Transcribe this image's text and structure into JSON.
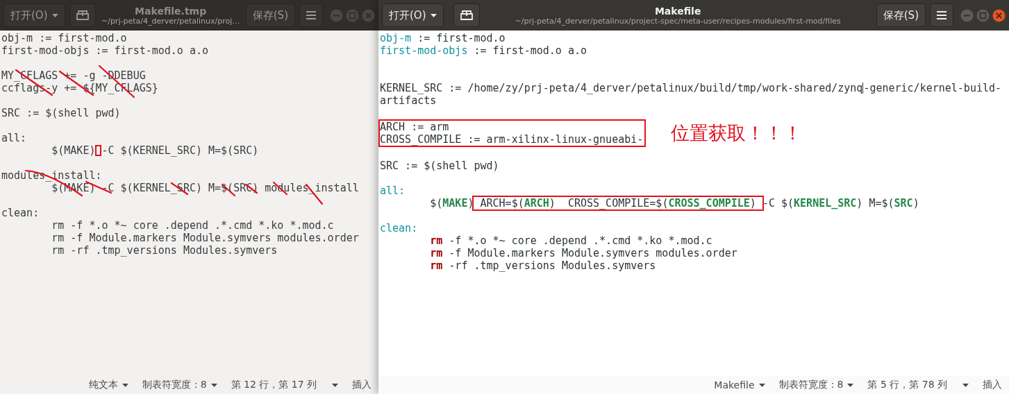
{
  "windows": [
    {
      "active": false,
      "struck_out": true,
      "open_button": "打开(O)",
      "save_button": "保存(S)",
      "title": "Makefile.tmp",
      "path": "~/prj-peta/4_derver/petalinux/proj…",
      "lines": [
        {
          "kind": "code",
          "segments": [
            {
              "kind": "plain",
              "text": "obj-m := first-mod.o"
            }
          ]
        },
        {
          "kind": "code",
          "segments": [
            {
              "kind": "plain",
              "text": "first-mod-objs := first-mod.o a.o"
            }
          ]
        },
        {
          "kind": "blank"
        },
        {
          "kind": "code",
          "segments": [
            {
              "kind": "plain",
              "text": "MY_CFLAGS += -g -DDEBUG"
            }
          ]
        },
        {
          "kind": "code",
          "segments": [
            {
              "kind": "plain",
              "text": "ccflags-y += ${MY_CFLAGS}"
            }
          ]
        },
        {
          "kind": "blank"
        },
        {
          "kind": "code",
          "segments": [
            {
              "kind": "plain",
              "text": "SRC := $(shell pwd)"
            }
          ]
        },
        {
          "kind": "blank"
        },
        {
          "kind": "code",
          "segments": [
            {
              "kind": "plain",
              "text": "all:"
            }
          ]
        },
        {
          "kind": "code",
          "indented": true,
          "segments": [
            {
              "kind": "plain",
              "text": "$(MAKE)"
            },
            {
              "kind": "gap-box"
            },
            {
              "kind": "plain",
              "text": "-C $(KERNEL_SRC) M=$(SRC)"
            }
          ]
        },
        {
          "kind": "blank"
        },
        {
          "kind": "code",
          "segments": [
            {
              "kind": "plain",
              "text": "modules_install:"
            }
          ]
        },
        {
          "kind": "code",
          "indented": true,
          "segments": [
            {
              "kind": "plain",
              "text": "$(MAKE) -C $(KERNEL_SRC) M=$(SRC) modules_install"
            }
          ]
        },
        {
          "kind": "blank"
        },
        {
          "kind": "code",
          "segments": [
            {
              "kind": "plain",
              "text": "clean:"
            }
          ]
        },
        {
          "kind": "code",
          "indented": true,
          "segments": [
            {
              "kind": "plain",
              "text": "rm -f *.o *~ core .depend .*.cmd *.ko *.mod.c"
            }
          ]
        },
        {
          "kind": "code",
          "indented": true,
          "segments": [
            {
              "kind": "plain",
              "text": "rm -f Module.markers Module.symvers modules.order"
            }
          ]
        },
        {
          "kind": "code",
          "indented": true,
          "segments": [
            {
              "kind": "plain",
              "text": "rm -rf .tmp_versions Modules.symvers"
            }
          ]
        }
      ],
      "status_bar": [
        {
          "label": "纯文本",
          "dropdown": true
        },
        {
          "label": "制表符宽度：8",
          "dropdown": true
        },
        {
          "label": "第 12 行，第 17 列",
          "dropdown": true
        },
        {
          "label": "插入",
          "dropdown": false
        }
      ]
    },
    {
      "active": true,
      "struck_out": false,
      "open_button": "打开(O)",
      "save_button": "保存(S)",
      "title": "Makefile",
      "path": "~/prj-peta/4_derver/petalinux/project-spec/meta-user/recipes-modules/first-mod/files",
      "lines": [
        {
          "kind": "code",
          "segments": [
            {
              "kind": "ident",
              "text": "obj-m"
            },
            {
              "kind": "plain",
              "text": " := first-mod.o"
            }
          ]
        },
        {
          "kind": "code",
          "segments": [
            {
              "kind": "ident",
              "text": "first-mod-objs"
            },
            {
              "kind": "plain",
              "text": " := first-mod.o a.o"
            }
          ]
        },
        {
          "kind": "blank"
        },
        {
          "kind": "blank"
        },
        {
          "kind": "code",
          "segments": [
            {
              "kind": "plain",
              "text": "KERNEL_SRC := /home/zy/prj-peta/4_derver/petalinux/build/tmp/work-shared/zynq"
            },
            {
              "kind": "cursor"
            },
            {
              "kind": "plain",
              "text": "-generic/kernel-build-"
            }
          ]
        },
        {
          "kind": "code",
          "segments": [
            {
              "kind": "plain",
              "text": "artifacts"
            }
          ]
        },
        {
          "kind": "blank"
        },
        {
          "kind": "group",
          "note": "位置获取！！！",
          "lines": [
            {
              "kind": "code",
              "segments": [
                {
                  "kind": "plain",
                  "text": "ARCH := arm"
                }
              ]
            },
            {
              "kind": "code",
              "segments": [
                {
                  "kind": "plain",
                  "text": "CROSS_COMPILE := arm-xilinx-linux-gnueabi-"
                }
              ]
            }
          ]
        },
        {
          "kind": "blank"
        },
        {
          "kind": "code",
          "segments": [
            {
              "kind": "plain",
              "text": "SRC := $(shell pwd)"
            }
          ]
        },
        {
          "kind": "blank"
        },
        {
          "kind": "code",
          "segments": [
            {
              "kind": "ident",
              "text": "all:"
            }
          ]
        },
        {
          "kind": "code",
          "indented": true,
          "segments": [
            {
              "kind": "plain",
              "text": "$("
            },
            {
              "kind": "var",
              "text": "MAKE"
            },
            {
              "kind": "plain",
              "text": ")"
            },
            {
              "kind": "box",
              "children": [
                {
                  "kind": "plain",
                  "text": " ARCH=$("
                },
                {
                  "kind": "var",
                  "text": "ARCH"
                },
                {
                  "kind": "plain",
                  "text": ")  CROSS_COMPILE=$("
                },
                {
                  "kind": "var",
                  "text": "CROSS_COMPILE"
                },
                {
                  "kind": "plain",
                  "text": ") "
                }
              ]
            },
            {
              "kind": "plain",
              "text": "-C $("
            },
            {
              "kind": "var",
              "text": "KERNEL_SRC"
            },
            {
              "kind": "plain",
              "text": ") M=$("
            },
            {
              "kind": "var",
              "text": "SRC"
            },
            {
              "kind": "plain",
              "text": ")"
            }
          ]
        },
        {
          "kind": "blank"
        },
        {
          "kind": "code",
          "segments": [
            {
              "kind": "ident",
              "text": "clean:"
            }
          ]
        },
        {
          "kind": "code",
          "indented": true,
          "segments": [
            {
              "kind": "cmd",
              "text": "rm"
            },
            {
              "kind": "plain",
              "text": " -f *.o *~ core .depend .*.cmd *.ko *.mod.c"
            }
          ]
        },
        {
          "kind": "code",
          "indented": true,
          "segments": [
            {
              "kind": "cmd",
              "text": "rm"
            },
            {
              "kind": "plain",
              "text": " -f Module.markers Module.symvers modules.order"
            }
          ]
        },
        {
          "kind": "code",
          "indented": true,
          "segments": [
            {
              "kind": "cmd",
              "text": "rm"
            },
            {
              "kind": "plain",
              "text": " -rf .tmp_versions Modules.symvers"
            }
          ]
        }
      ],
      "status_bar": [
        {
          "label": "Makefile",
          "dropdown": true
        },
        {
          "label": "制表符宽度：8",
          "dropdown": true
        },
        {
          "label": "第 5 行，第 78 列",
          "dropdown": true
        },
        {
          "label": "插入",
          "dropdown": false
        }
      ]
    }
  ]
}
